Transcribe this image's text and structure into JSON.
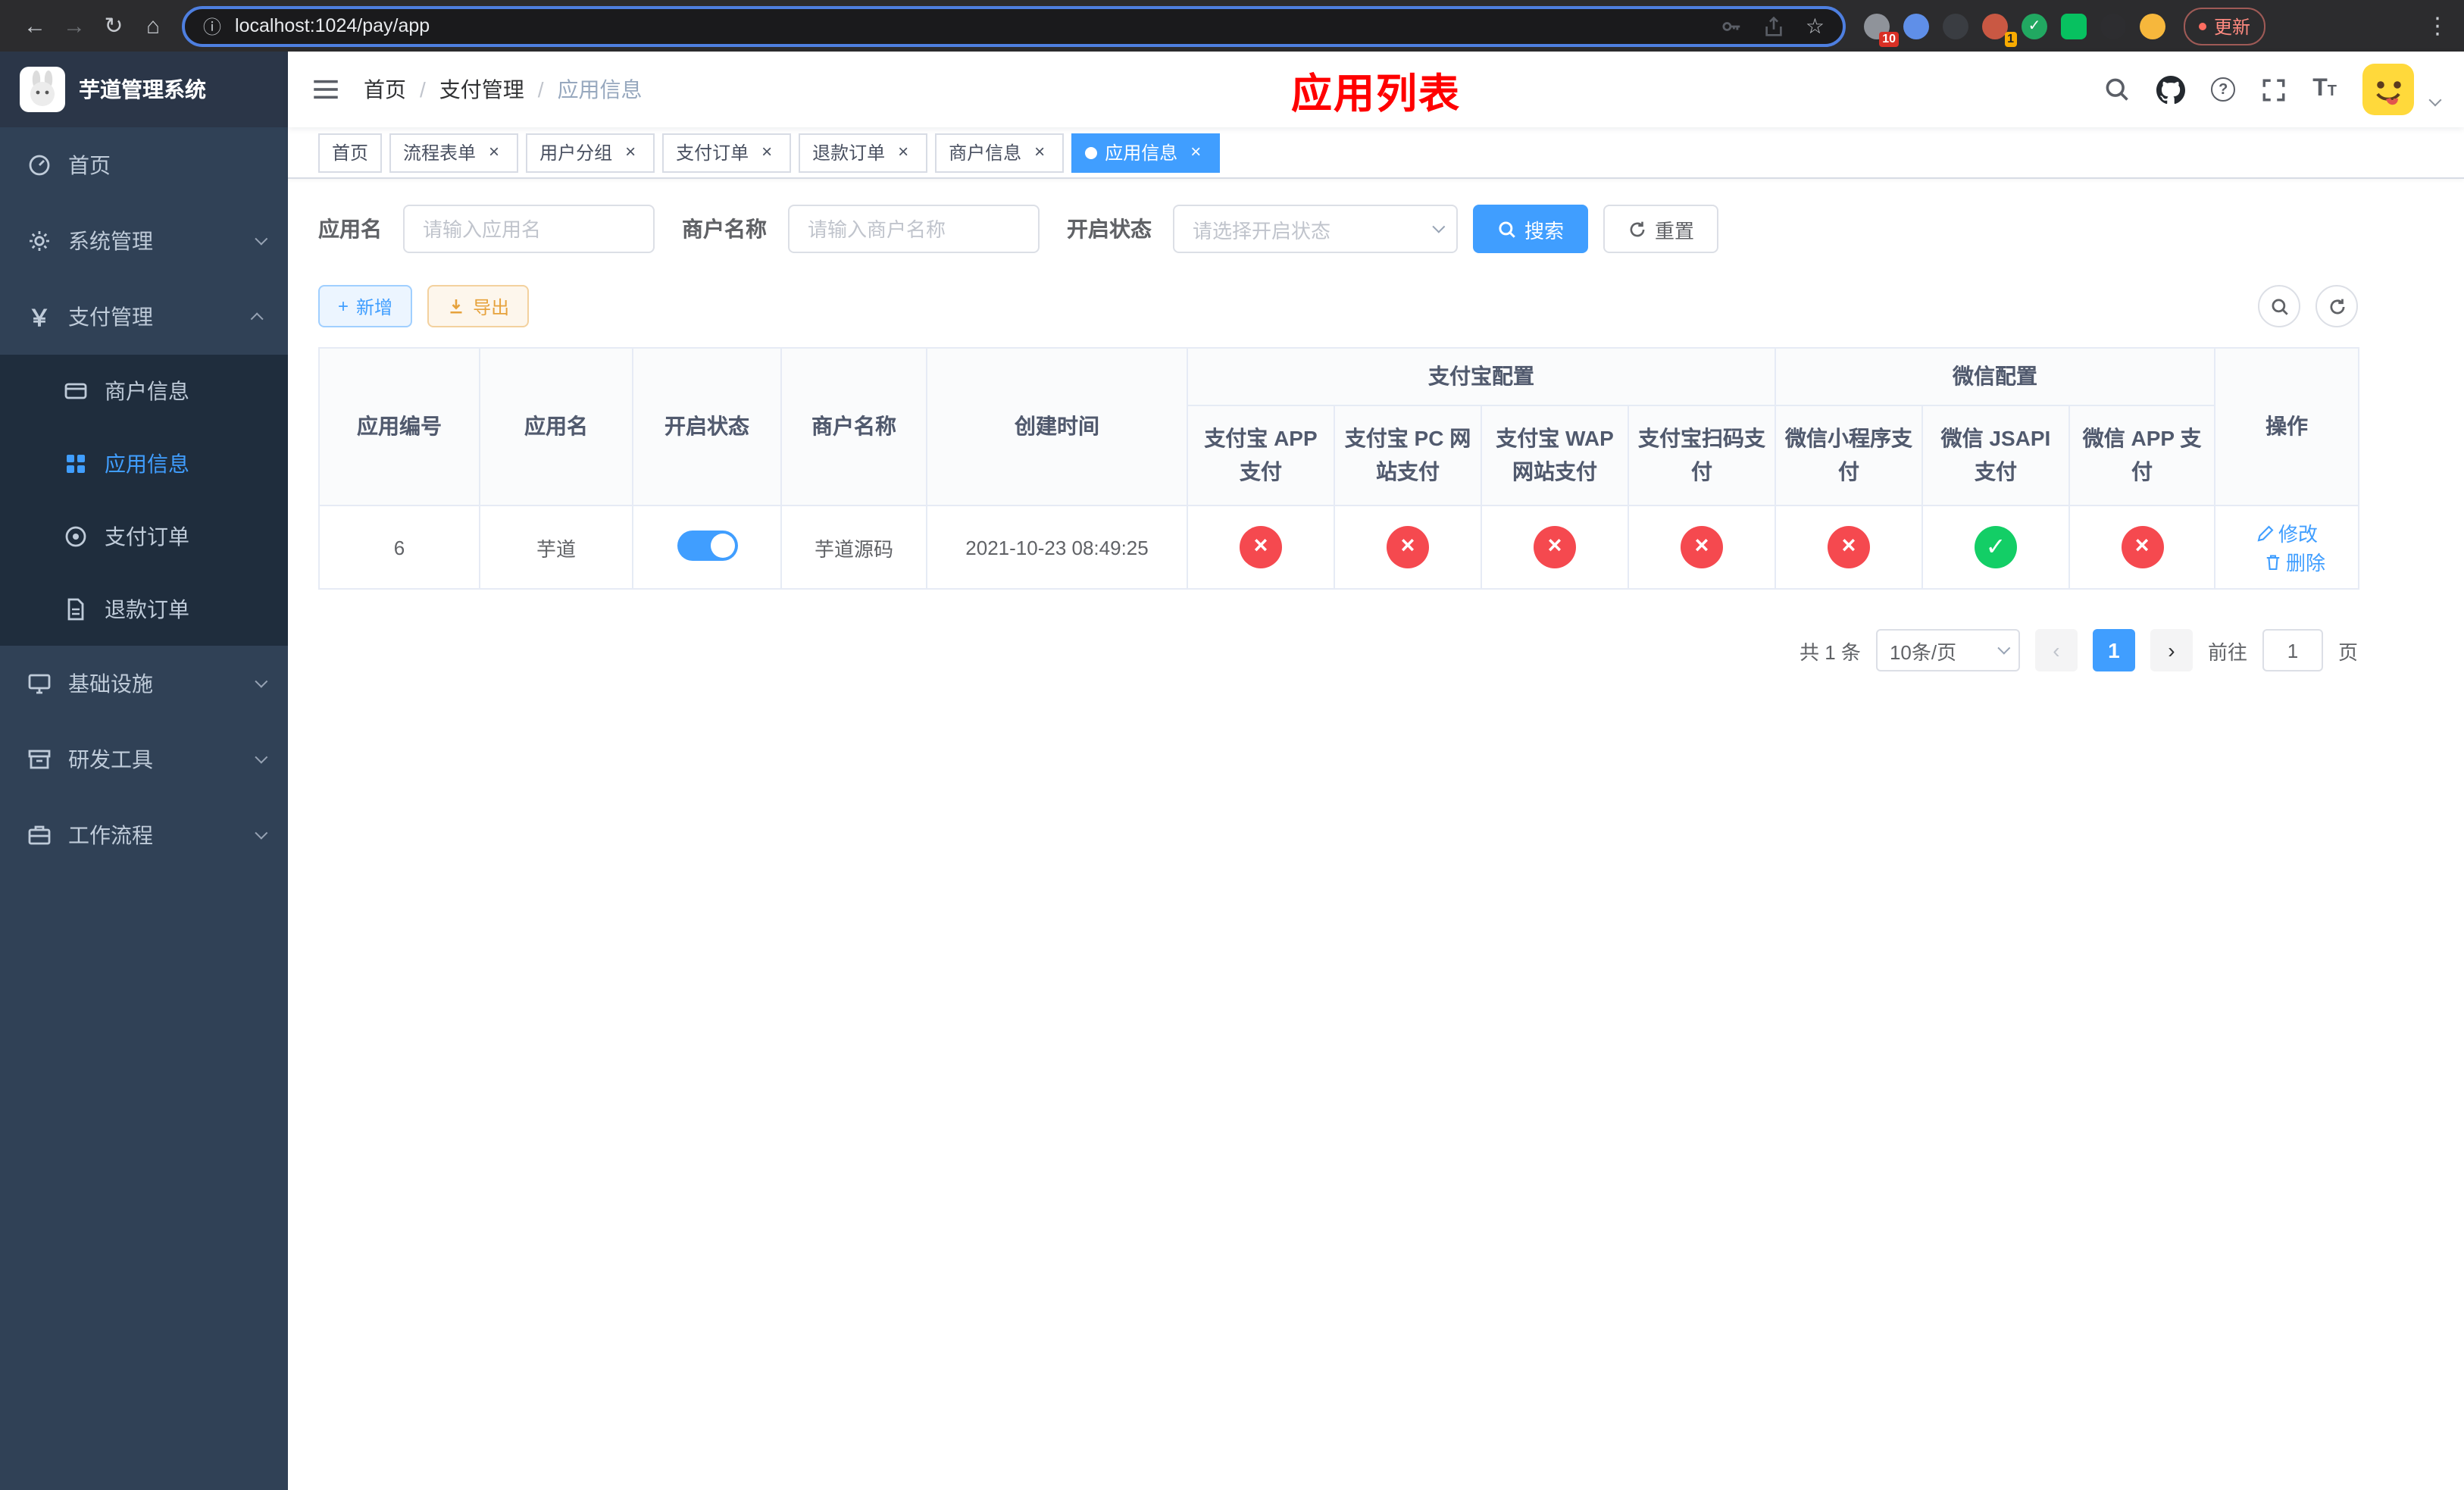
{
  "browser": {
    "url": "localhost:1024/pay/app",
    "update_label": "更新",
    "ext_badge_1": "10",
    "ext_badge_2": "1"
  },
  "sidebar": {
    "title": "芋道管理系统",
    "home": "首页",
    "system": "系统管理",
    "payment": "支付管理",
    "merchant_info": "商户信息",
    "app_info": "应用信息",
    "pay_order": "支付订单",
    "refund_order": "退款订单",
    "infrastructure": "基础设施",
    "dev_tools": "研发工具",
    "workflow": "工作流程"
  },
  "header": {
    "breadcrumb": [
      "首页",
      "支付管理",
      "应用信息"
    ],
    "page_title": "应用列表"
  },
  "tabs": [
    {
      "label": "首页"
    },
    {
      "label": "流程表单"
    },
    {
      "label": "用户分组"
    },
    {
      "label": "支付订单"
    },
    {
      "label": "退款订单"
    },
    {
      "label": "商户信息"
    },
    {
      "label": "应用信息"
    }
  ],
  "filters": {
    "app_name_label": "应用名",
    "app_name_placeholder": "请输入应用名",
    "merchant_label": "商户名称",
    "merchant_placeholder": "请输入商户名称",
    "status_label": "开启状态",
    "status_placeholder": "请选择开启状态",
    "search": "搜索",
    "reset": "重置"
  },
  "toolbar": {
    "add": "新增",
    "export": "导出"
  },
  "table": {
    "col_app_id": "应用编号",
    "col_app_name": "应用名",
    "col_status": "开启状态",
    "col_merchant": "商户名称",
    "col_created": "创建时间",
    "group_alipay": "支付宝配置",
    "group_wechat": "微信配置",
    "col_alipay_app": "支付宝 APP 支付",
    "col_alipay_pc": "支付宝 PC 网站支付",
    "col_alipay_wap": "支付宝 WAP 网站支付",
    "col_alipay_qr": "支付宝扫码支付",
    "col_wx_mini": "微信小程序支付",
    "col_wx_jsapi": "微信 JSAPI 支付",
    "col_wx_app": "微信 APP 支付",
    "col_actions": "操作",
    "status_icons": {
      "success": "✓",
      "fail": "×"
    },
    "row": {
      "id": "6",
      "name": "芋道",
      "status_on": true,
      "merchant": "芋道源码",
      "created": "2021-10-23 08:49:25",
      "configs": [
        false,
        false,
        false,
        false,
        false,
        true,
        false
      ],
      "edit": "修改",
      "delete": "删除"
    }
  },
  "pagination": {
    "total": "共 1 条",
    "page_size": "10条/页",
    "page": "1",
    "goto_label": "前往",
    "goto_value": "1",
    "unit": "页"
  },
  "colors": {
    "accent": "#409eff",
    "success": "#13ce66",
    "fail": "#f5494f",
    "title_red": "#ff0000",
    "sidebar_bg": "#304156",
    "submenu_bg": "#1f2d3d"
  }
}
